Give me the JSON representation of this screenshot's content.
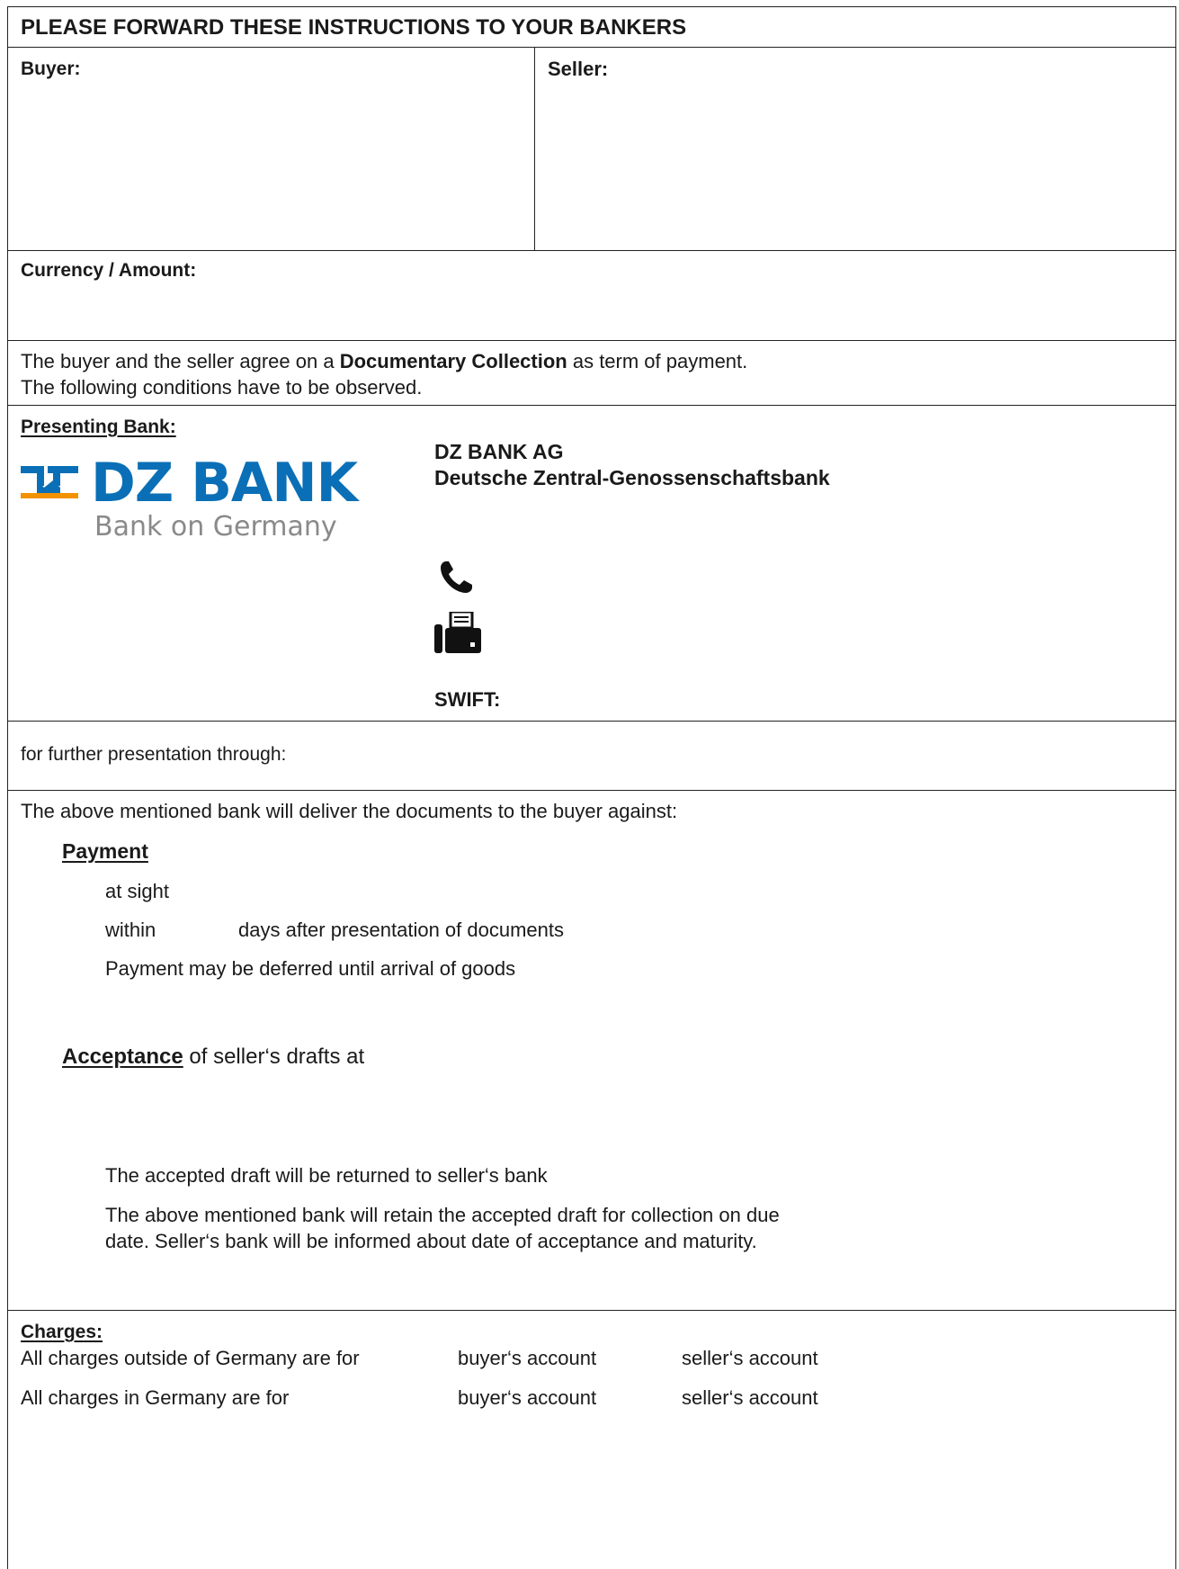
{
  "header": {
    "title": "PLEASE FORWARD THESE INSTRUCTIONS TO YOUR BANKERS"
  },
  "parties": {
    "buyer_label": "Buyer:",
    "seller_label": "Seller:"
  },
  "currency": {
    "label": "Currency / Amount:"
  },
  "agreement": {
    "line1_pre": "The buyer and the seller agree on a ",
    "line1_bold": "Documentary Collection",
    "line1_post": " as term of payment.",
    "line2": "The following conditions have to be observed."
  },
  "presenting_bank": {
    "label": "Presenting Bank:",
    "logo_name": "DZ BANK",
    "logo_tagline": "Bank on Germany",
    "name_line1": "DZ BANK AG",
    "name_line2": "Deutsche Zentral-Genossenschaftsbank",
    "phone_icon": "phone-icon",
    "fax_icon": "fax-icon",
    "swift_label": "SWIFT:"
  },
  "further": {
    "label": "for further presentation through:"
  },
  "delivery": {
    "intro": "The above mentioned bank will deliver the documents to the buyer against:",
    "payment_heading": "Payment",
    "payment_options": {
      "at_sight": "at sight",
      "within": "within",
      "days_after": "days after presentation of documents",
      "deferred": "Payment may be deferred until arrival of goods"
    },
    "acceptance_heading": "Acceptance",
    "acceptance_rest": " of seller‘s drafts at",
    "acceptance_options": {
      "returned": "The accepted draft will be returned to seller‘s bank",
      "retain_line1": "The above mentioned bank will retain the accepted draft for collection on due",
      "retain_line2": "date. Seller‘s bank will be informed about date of acceptance and maturity."
    }
  },
  "charges": {
    "label": "Charges:",
    "row1": {
      "label": "All charges outside of Germany are for",
      "opt1": "buyer‘s account",
      "opt2": "seller‘s account"
    },
    "row2": {
      "label": "All charges in Germany are for",
      "opt1": "buyer‘s account",
      "opt2": "seller‘s account"
    }
  },
  "colors": {
    "brand_blue": "#0a6fb6",
    "brand_orange": "#f39200",
    "tagline_gray": "#8a8a8a",
    "border": "#222222"
  }
}
